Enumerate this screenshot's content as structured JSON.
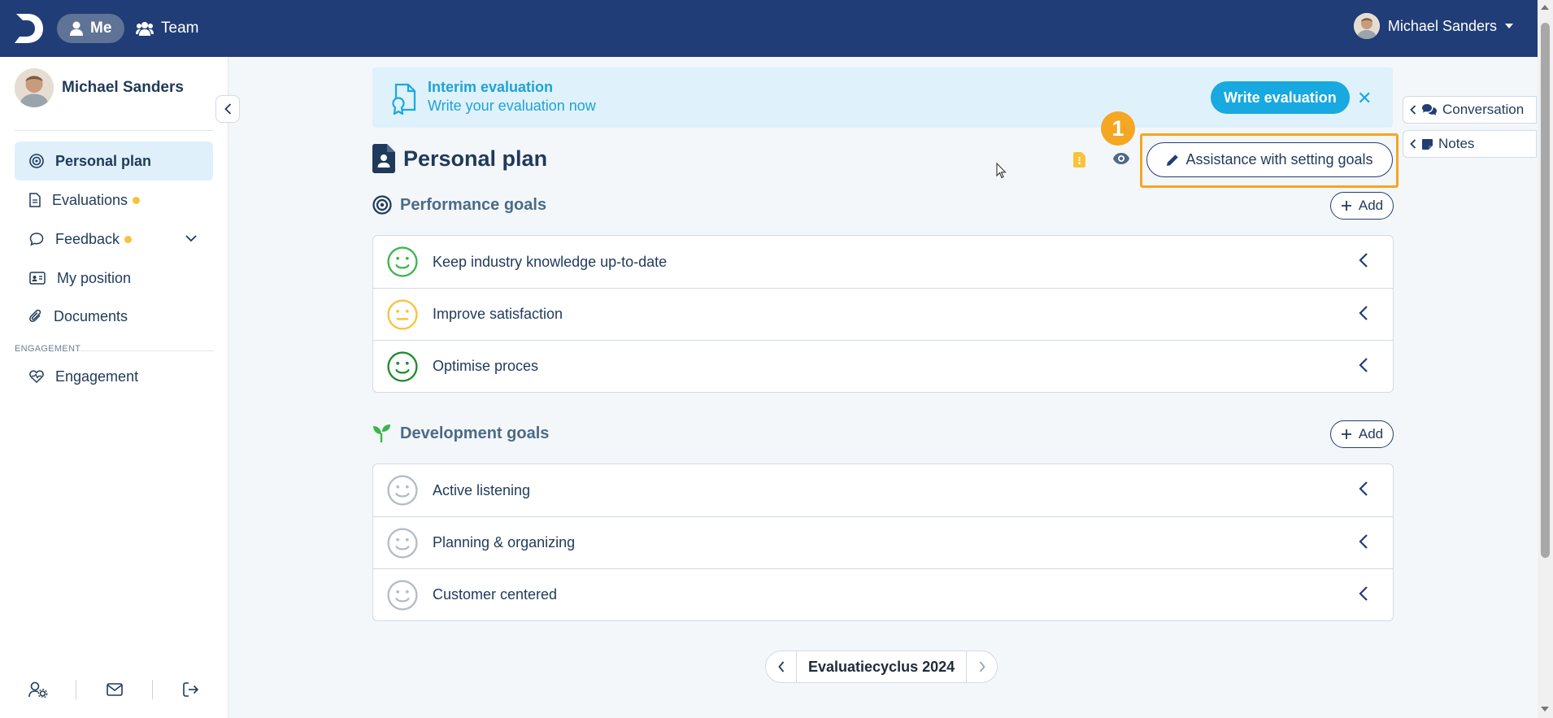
{
  "topbar": {
    "logo": "D",
    "nav": [
      {
        "label": "Me",
        "icon": "user-icon",
        "active": true
      },
      {
        "label": "Team",
        "icon": "users-icon",
        "active": false
      }
    ],
    "user_name": "Michael Sanders"
  },
  "sidebar": {
    "profile_name": "Michael Sanders",
    "items": [
      {
        "label": "Personal plan",
        "icon": "target-icon",
        "active": true
      },
      {
        "label": "Evaluations",
        "icon": "file-icon",
        "notification": true
      },
      {
        "label": "Feedback",
        "icon": "chat-icon",
        "notification": true,
        "expandable": true
      },
      {
        "label": "My position",
        "icon": "id-card-icon"
      },
      {
        "label": "Documents",
        "icon": "paperclip-icon"
      }
    ],
    "section_label": "ENGAGEMENT",
    "section_items": [
      {
        "label": "Engagement",
        "icon": "heart-pulse-icon"
      }
    ],
    "footer_icons": [
      "user-settings-icon",
      "mail-icon",
      "logout-icon"
    ]
  },
  "banner": {
    "title": "Interim evaluation",
    "subtitle": "Write your evaluation now",
    "button_label": "Write evaluation",
    "close": "✕"
  },
  "main": {
    "title": "Personal plan",
    "step_badge": "1",
    "assist_button_label": "Assistance with setting goals",
    "side_tabs": [
      {
        "label": "Conversation",
        "icon": "comments-icon"
      },
      {
        "label": "Notes",
        "icon": "note-icon"
      }
    ]
  },
  "performance": {
    "title": "Performance goals",
    "add_label": "Add",
    "goals": [
      {
        "label": "Keep industry knowledge up-to-date",
        "status": "happy",
        "color": "#3cb54a"
      },
      {
        "label": "Improve satisfaction",
        "status": "neutral",
        "color": "#f8c33a"
      },
      {
        "label": "Optimise proces",
        "status": "happy",
        "color": "#1e8a2e"
      }
    ]
  },
  "development": {
    "title": "Development goals",
    "add_label": "Add",
    "goals": [
      {
        "label": "Active listening",
        "status": "none",
        "color": "#b3bcc6"
      },
      {
        "label": "Planning & organizing",
        "status": "none",
        "color": "#b3bcc6"
      },
      {
        "label": "Customer centered",
        "status": "none",
        "color": "#b3bcc6"
      }
    ]
  },
  "pager": {
    "label": "Evaluatiecyclus 2024"
  },
  "colors": {
    "primary": "#213d77",
    "accent": "#17a9df",
    "highlight": "#f5a623",
    "notification": "#f8c33a"
  }
}
